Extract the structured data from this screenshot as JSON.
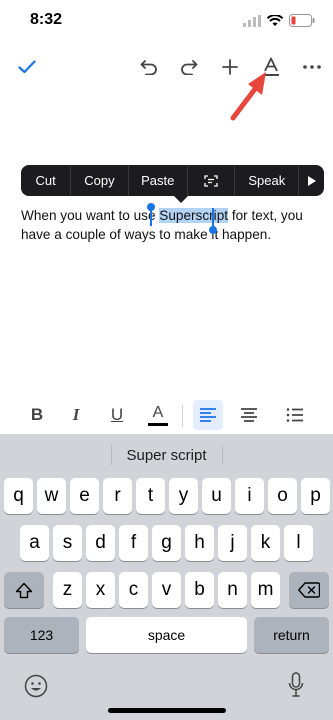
{
  "status_bar": {
    "time": "8:32"
  },
  "toolbar": {
    "icons": [
      "checkmark-icon",
      "undo-icon",
      "redo-icon",
      "plus-icon",
      "text-format-icon",
      "more-icon"
    ]
  },
  "context_menu": {
    "items": [
      "Cut",
      "Copy",
      "Paste",
      "Speak"
    ],
    "scan_icon": "scan-text-icon",
    "more_icon": "arrow-right-icon"
  },
  "document": {
    "before": "When you want to use ",
    "selected": "Superscript",
    "after": " for text, you have a couple of ways to make it happen."
  },
  "annotation": {
    "color": "#e8453c"
  },
  "format_bar": {
    "bold": "B",
    "italic": "I",
    "underline": "U",
    "text_color": "A"
  },
  "keyboard": {
    "suggestion": "Super script",
    "row1": [
      "q",
      "w",
      "e",
      "r",
      "t",
      "y",
      "u",
      "i",
      "o",
      "p"
    ],
    "row2": [
      "a",
      "s",
      "d",
      "f",
      "g",
      "h",
      "j",
      "k",
      "l"
    ],
    "row3": [
      "z",
      "x",
      "c",
      "v",
      "b",
      "n",
      "m"
    ],
    "numbers_key": "123",
    "space_key": "space",
    "return_key": "return"
  },
  "colors": {
    "accent": "#1a73e8",
    "selection": "#b3d3f5",
    "keyboard_bg": "#d1d3d9",
    "context_bg": "#1c1c1e"
  }
}
